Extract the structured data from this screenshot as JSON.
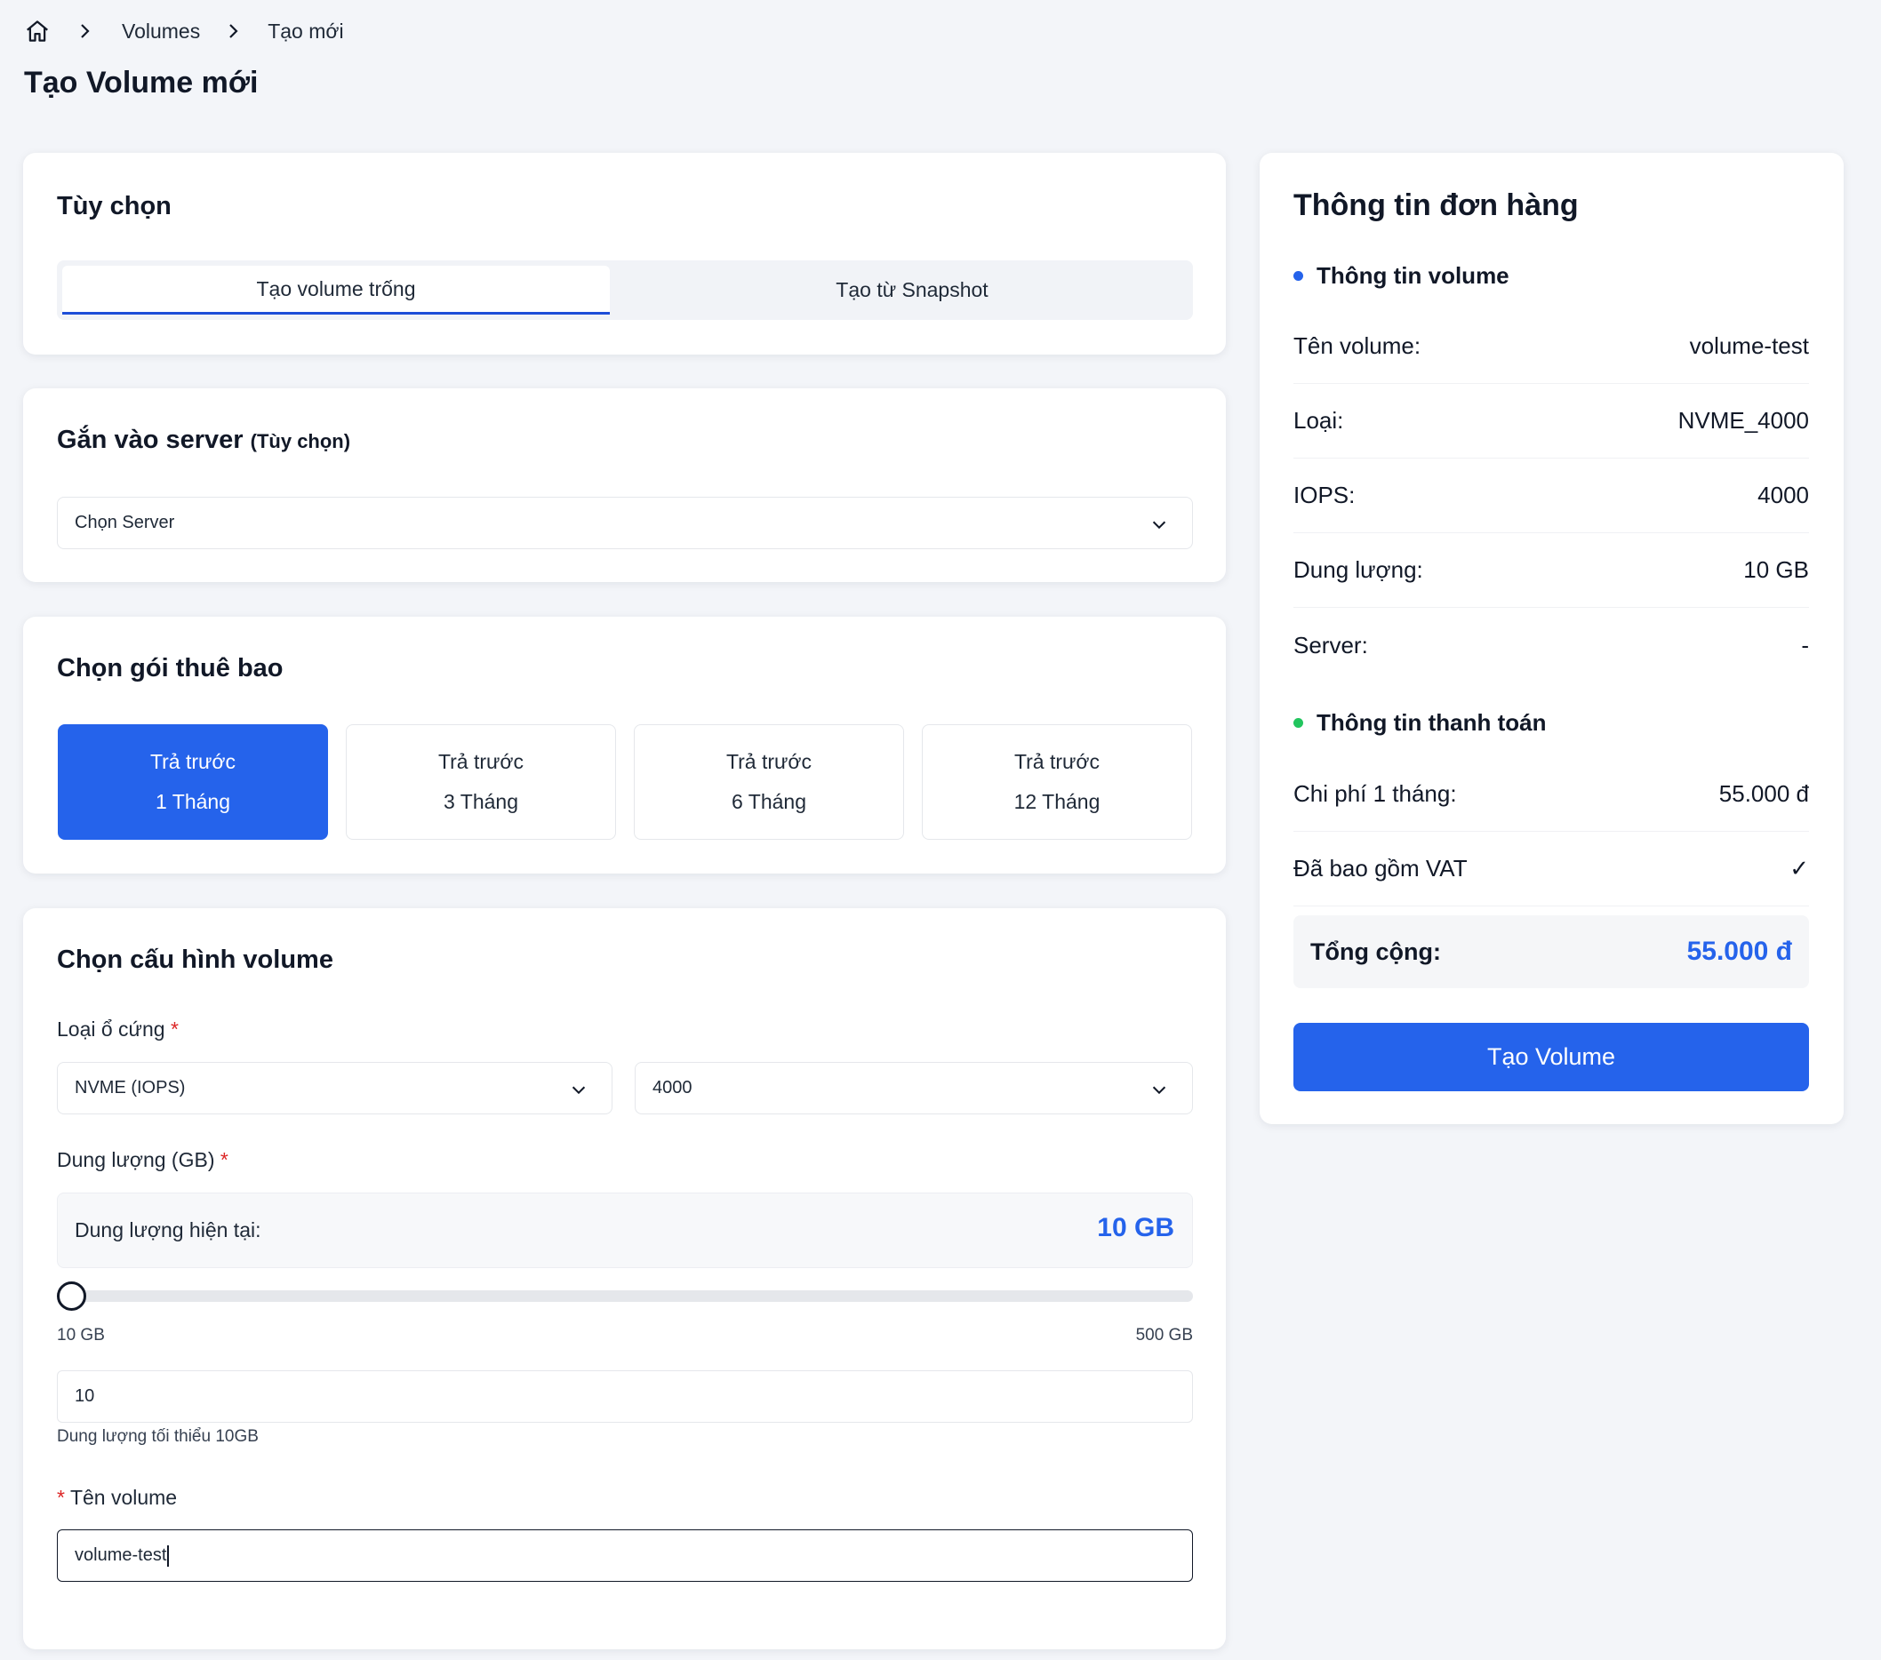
{
  "breadcrumb": {
    "home_icon": "home-icon",
    "items": [
      "Volumes",
      "Tạo mới"
    ]
  },
  "page_title": "Tạo Volume mới",
  "options_card": {
    "title": "Tùy chọn",
    "tabs": [
      {
        "label": "Tạo volume trống",
        "active": true
      },
      {
        "label": "Tạo từ Snapshot",
        "active": false
      }
    ]
  },
  "attach_card": {
    "title": "Gắn vào server",
    "subtitle": "(Tùy chọn)",
    "server_select": "Chọn Server"
  },
  "plan_card": {
    "title": "Chọn gói thuê bao",
    "plans": [
      {
        "line1": "Trả trước",
        "line2": "1 Tháng",
        "selected": true
      },
      {
        "line1": "Trả trước",
        "line2": "3 Tháng",
        "selected": false
      },
      {
        "line1": "Trả trước",
        "line2": "6 Tháng",
        "selected": false
      },
      {
        "line1": "Trả trước",
        "line2": "12 Tháng",
        "selected": false
      }
    ]
  },
  "config_card": {
    "title": "Chọn cấu hình volume",
    "disk_type_label": "Loại ổ cứng",
    "required_mark": "*",
    "disk_type_value": "NVME (IOPS)",
    "iops_value": "4000",
    "capacity_label": "Dung lượng (GB)",
    "current_capacity_label": "Dung lượng hiện tại:",
    "current_capacity_value": "10 GB",
    "slider": {
      "min_label": "10 GB",
      "max_label": "500 GB",
      "min": 10,
      "max": 500,
      "value": 10
    },
    "capacity_input": "10",
    "capacity_hint": "Dung lượng tối thiểu 10GB",
    "volume_name_label": "Tên volume",
    "volume_name_value": "volume-test"
  },
  "summary": {
    "title": "Thông tin đơn hàng",
    "volume_section": "Thông tin volume",
    "volume_rows": [
      {
        "k": "Tên volume:",
        "v": "volume-test"
      },
      {
        "k": "Loại:",
        "v": "NVME_4000"
      },
      {
        "k": "IOPS:",
        "v": "4000"
      },
      {
        "k": "Dung lượng:",
        "v": "10 GB"
      },
      {
        "k": "Server:",
        "v": "-"
      }
    ],
    "payment_section": "Thông tin thanh toán",
    "payment_rows": [
      {
        "k": "Chi phí 1 tháng:",
        "v": "55.000 đ"
      },
      {
        "k": "Đã bao gồm VAT",
        "v": "✓"
      }
    ],
    "total_label": "Tổng cộng:",
    "total_value": "55.000 đ",
    "create_button": "Tạo Volume"
  },
  "colors": {
    "accent": "#2563eb",
    "volume_dot": "#2563eb",
    "payment_dot": "#22c55e",
    "required": "#dc2626"
  }
}
